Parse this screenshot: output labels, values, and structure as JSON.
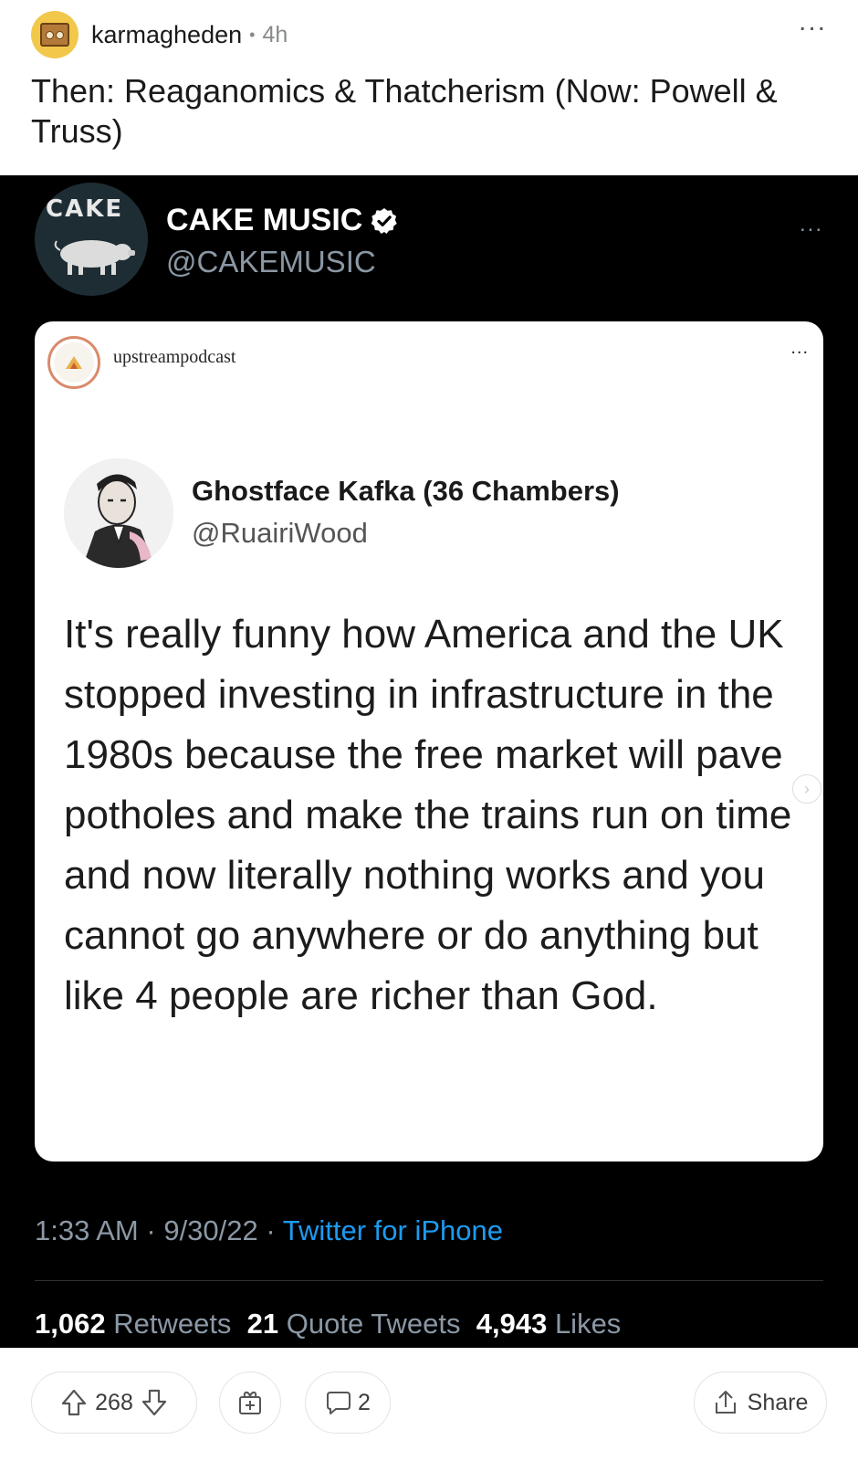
{
  "post": {
    "username": "karmagheden",
    "separator": "•",
    "time": "4h",
    "more": "...",
    "title": "Then: Reaganomics & Thatcherism (Now: Powell & Truss)"
  },
  "tweet": {
    "avatar_text": "CAKE",
    "display_name": "CAKE MUSIC",
    "handle": "@CAKEMUSIC",
    "more": "...",
    "embedded": {
      "ig_account": "upstreampodcast",
      "ig_more": "...",
      "author_name": "Ghostface Kafka (36 Chambers)",
      "author_handle": "@RuairiWood",
      "text": "It's really funny how America and the UK stopped investing in infrastructure in the 1980s because the free market will pave potholes and make the trains run on time and now literally nothing works and you cannot go anywhere or do anything but like 4 people are richer than God.",
      "next_arrow": "›"
    },
    "time": "1:33 AM",
    "date": "9/30/22",
    "meta_sep": "·",
    "source": "Twitter for iPhone",
    "retweets_count": "1,062",
    "retweets_label": "Retweets",
    "quotes_count": "21",
    "quotes_label": "Quote Tweets",
    "likes_count": "4,943",
    "likes_label": "Likes"
  },
  "actions": {
    "vote_count": "268",
    "comment_count": "2",
    "share_label": "Share"
  },
  "icons": {
    "upvote": "upvote-arrow-icon",
    "downvote": "downvote-arrow-icon",
    "award": "award-gift-icon",
    "comment": "comment-bubble-icon",
    "share": "share-upload-icon",
    "verified": "verified-badge-icon"
  },
  "colors": {
    "tweet_background": "#000000",
    "link_blue": "#1d9bf0",
    "muted_gray": "#8b98a5"
  }
}
